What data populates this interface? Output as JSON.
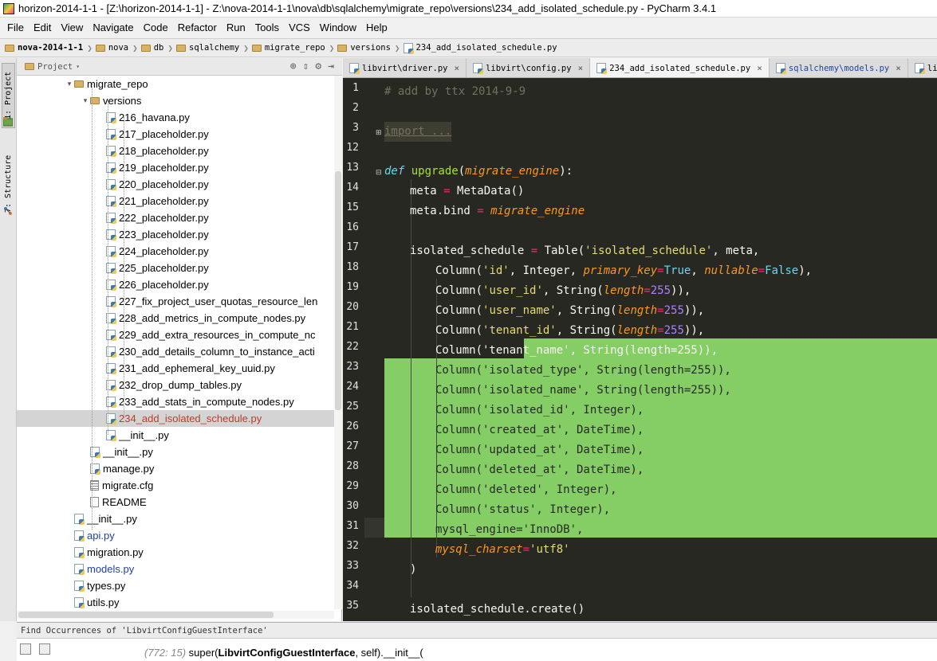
{
  "window": {
    "title": "horizon-2014-1-1 - [Z:\\horizon-2014-1-1] - Z:\\nova-2014-1-1\\nova\\db\\sqlalchemy\\migrate_repo\\versions\\234_add_isolated_schedule.py - PyCharm 3.4.1"
  },
  "menu": [
    "File",
    "Edit",
    "View",
    "Navigate",
    "Code",
    "Refactor",
    "Run",
    "Tools",
    "VCS",
    "Window",
    "Help"
  ],
  "breadcrumb": [
    {
      "label": "nova-2014-1-1",
      "icon": "folder-icon"
    },
    {
      "label": "nova",
      "icon": "folder-icon"
    },
    {
      "label": "db",
      "icon": "folder-icon"
    },
    {
      "label": "sqlalchemy",
      "icon": "folder-icon"
    },
    {
      "label": "migrate_repo",
      "icon": "folder-icon"
    },
    {
      "label": "versions",
      "icon": "folder-icon"
    },
    {
      "label": "234_add_isolated_schedule.py",
      "icon": "python-file-icon"
    }
  ],
  "toolwindows": {
    "project_tab": "1: Project",
    "structure_tab": "7: Structure"
  },
  "project_panel": {
    "title": "Project",
    "tree": [
      {
        "label": "migrate_repo",
        "type": "folder",
        "depth": 4,
        "expanded": true
      },
      {
        "label": "versions",
        "type": "folder",
        "depth": 5,
        "expanded": true
      },
      {
        "label": "216_havana.py",
        "type": "py",
        "depth": 6
      },
      {
        "label": "217_placeholder.py",
        "type": "py",
        "depth": 6
      },
      {
        "label": "218_placeholder.py",
        "type": "py",
        "depth": 6
      },
      {
        "label": "219_placeholder.py",
        "type": "py",
        "depth": 6
      },
      {
        "label": "220_placeholder.py",
        "type": "py",
        "depth": 6
      },
      {
        "label": "221_placeholder.py",
        "type": "py",
        "depth": 6
      },
      {
        "label": "222_placeholder.py",
        "type": "py",
        "depth": 6
      },
      {
        "label": "223_placeholder.py",
        "type": "py",
        "depth": 6
      },
      {
        "label": "224_placeholder.py",
        "type": "py",
        "depth": 6
      },
      {
        "label": "225_placeholder.py",
        "type": "py",
        "depth": 6
      },
      {
        "label": "226_placeholder.py",
        "type": "py",
        "depth": 6
      },
      {
        "label": "227_fix_project_user_quotas_resource_len",
        "type": "py",
        "depth": 6
      },
      {
        "label": "228_add_metrics_in_compute_nodes.py",
        "type": "py",
        "depth": 6
      },
      {
        "label": "229_add_extra_resources_in_compute_nc",
        "type": "py",
        "depth": 6
      },
      {
        "label": "230_add_details_column_to_instance_acti",
        "type": "py",
        "depth": 6
      },
      {
        "label": "231_add_ephemeral_key_uuid.py",
        "type": "py",
        "depth": 6
      },
      {
        "label": "232_drop_dump_tables.py",
        "type": "py",
        "depth": 6
      },
      {
        "label": "233_add_stats_in_compute_nodes.py",
        "type": "py",
        "depth": 6
      },
      {
        "label": "234_add_isolated_schedule.py",
        "type": "py",
        "depth": 6,
        "selected": true,
        "color": "red"
      },
      {
        "label": "__init__.py",
        "type": "py",
        "depth": 6
      },
      {
        "label": "__init__.py",
        "type": "py",
        "depth": 5
      },
      {
        "label": "manage.py",
        "type": "py",
        "depth": 5
      },
      {
        "label": "migrate.cfg",
        "type": "cfg",
        "depth": 5
      },
      {
        "label": "README",
        "type": "file",
        "depth": 5
      },
      {
        "label": "__init__.py",
        "type": "py",
        "depth": 4
      },
      {
        "label": "api.py",
        "type": "py",
        "depth": 4,
        "color": "blue"
      },
      {
        "label": "migration.py",
        "type": "py",
        "depth": 4
      },
      {
        "label": "models.py",
        "type": "py",
        "depth": 4,
        "color": "blue"
      },
      {
        "label": "types.py",
        "type": "py",
        "depth": 4
      },
      {
        "label": "utils.py",
        "type": "py",
        "depth": 4
      }
    ]
  },
  "editor": {
    "tabs": [
      {
        "label": "libvirt\\driver.py",
        "active": false
      },
      {
        "label": "libvirt\\config.py",
        "active": false
      },
      {
        "label": "234_add_isolated_schedule.py",
        "active": true
      },
      {
        "label": "sqlalchemy\\models.py",
        "active": false,
        "blue": true
      },
      {
        "label": "lib",
        "active": false
      }
    ],
    "close_glyph": "×",
    "line_numbers": [
      "1",
      "2",
      "3",
      "12",
      "13",
      "14",
      "15",
      "16",
      "17",
      "18",
      "19",
      "20",
      "21",
      "22",
      "23",
      "24",
      "25",
      "26",
      "27",
      "28",
      "29",
      "30",
      "31",
      "32",
      "33",
      "34",
      "35"
    ],
    "code": {
      "l1": "# add by ttx 2014-9-9",
      "l3": "import ...",
      "l13_def": "def ",
      "l13_name": "upgrade",
      "l13_open": "(",
      "l13_param": "migrate_engine",
      "l13_close": "):",
      "l14_a": "meta ",
      "l14_op": "=",
      "l14_b": " MetaData()",
      "l15_a": "meta.bind ",
      "l15_op": "=",
      "l15_b": " migrate_engine",
      "l17_a": "isolated_schedule ",
      "l17_op": "=",
      "l17_b": " Table(",
      "l17_str": "'isolated_schedule'",
      "l17_c": ", meta,",
      "l18_a": "Column(",
      "l18_str": "'id'",
      "l18_b": ", Integer, ",
      "l18_k1": "primary_key",
      "l18_op1": "=",
      "l18_v1": "True",
      "l18_c": ", ",
      "l18_k2": "nullable",
      "l18_op2": "=",
      "l18_v2": "False",
      "l18_d": "),",
      "l19_a": "Column(",
      "l19_str": "'user_id'",
      "l19_b": ", String(",
      "l19_k": "length",
      "l19_op": "=",
      "l19_num": "255",
      "l19_c": ")),",
      "l20_a": "Column(",
      "l20_str": "'user_name'",
      "l20_b": ", String(",
      "l20_k": "length",
      "l20_op": "=",
      "l20_num": "255",
      "l20_c": ")),",
      "l21_a": "Column(",
      "l21_str": "'tenant_id'",
      "l21_b": ", String(",
      "l21_k": "length",
      "l21_op": "=",
      "l21_num": "255",
      "l21_c": ")),",
      "l22": "Column('tenant_name', String(length=255)),",
      "l23": "Column('isolated_type', String(length=255)),",
      "l24": "Column('isolated_name', String(length=255)),",
      "l25": "Column('isolated_id', Integer),",
      "l26": "Column('created_at', DateTime),",
      "l27": "Column('updated_at', DateTime),",
      "l28": "Column('deleted_at', DateTime),",
      "l29": "Column('deleted', Integer),",
      "l30": "Column('status', Integer),",
      "l31": "mysql_engine='InnoDB',",
      "l32_k": "mysql_charset",
      "l32_op": "=",
      "l32_str": "'utf8'",
      "l33": ")",
      "l35": "isolated_schedule.create()"
    }
  },
  "find_panel": {
    "title": "Find  Occurrences of 'LibvirtConfigGuestInterface'",
    "result_loc": "(772: 15)",
    "result_pre": " super(",
    "result_hit": "LibvirtConfigGuestInterface",
    "result_post": ", self).__init__("
  },
  "colors": {
    "editor_bg": "#272822",
    "selection": "#85ce66",
    "keyword": "#66d9ef",
    "string": "#e6db74",
    "number": "#ae81ff",
    "operator": "#f92672",
    "param": "#fd971f"
  }
}
